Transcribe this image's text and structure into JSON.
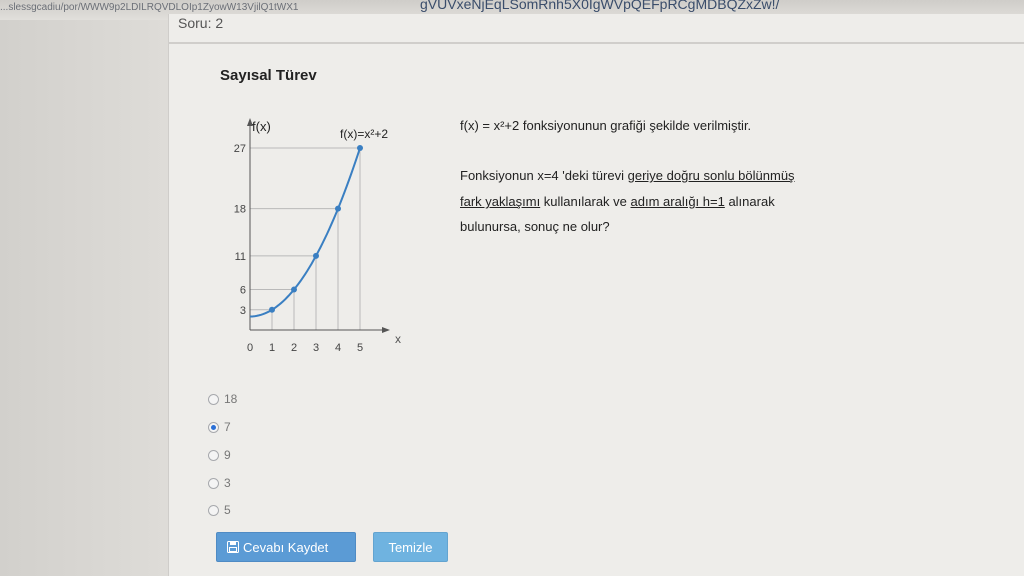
{
  "browser": {
    "url_left": "...slessgcadiu/por/WWW9p2LDILRQVDLOIp1ZyowW13VjilQ1tWX1",
    "url_right": "gVUVxeNjEqLSomRnh5X0IgWVpQEFpRCgMDBQZxZw!/"
  },
  "question": {
    "number_label": "Soru: 2",
    "title": "Sayısal Türev",
    "prompt_line1": "f(x) = x²+2 fonksiyonunun grafiği şekilde verilmiştir.",
    "prompt_line2_pre": "Fonksiyonun x=4 'deki türevi ",
    "prompt_line2_u": "geriye doğru sonlu bölünmüş",
    "prompt_line3_u1": "fark yaklaşımı",
    "prompt_line3_mid": " kullanılarak ve ",
    "prompt_line3_u2": "adım aralığı  h=1",
    "prompt_line3_post": "  alınarak",
    "prompt_line4": "bulunursa, sonuç ne olur?"
  },
  "graph": {
    "y_axis_label": "f(x)",
    "function_label": "f(x)=x²+2",
    "x_axis_label": "x",
    "x_ticks": [
      "0",
      "1",
      "2",
      "3",
      "4",
      "5"
    ],
    "y_ticks": [
      "3",
      "6",
      "11",
      "18",
      "27"
    ]
  },
  "chart_data": {
    "type": "line",
    "x": [
      0,
      1,
      2,
      3,
      4,
      5
    ],
    "y": [
      2,
      3,
      6,
      11,
      18,
      27
    ],
    "xlabel": "x",
    "ylabel": "f(x)"
  },
  "options": [
    {
      "label": "18",
      "checked": false
    },
    {
      "label": "7",
      "checked": true
    },
    {
      "label": "9",
      "checked": false
    },
    {
      "label": "3",
      "checked": false
    },
    {
      "label": "5",
      "checked": false
    }
  ],
  "buttons": {
    "save_label": "Cevabı Kaydet",
    "clear_label": "Temizle"
  },
  "icons": {
    "save": "floppy-disk-icon"
  },
  "colors": {
    "curve": "#3a7fc2",
    "save_button": "#5b9bd5",
    "clear_button": "#6fb3e0",
    "radio_selected": "#2a6fd6"
  }
}
